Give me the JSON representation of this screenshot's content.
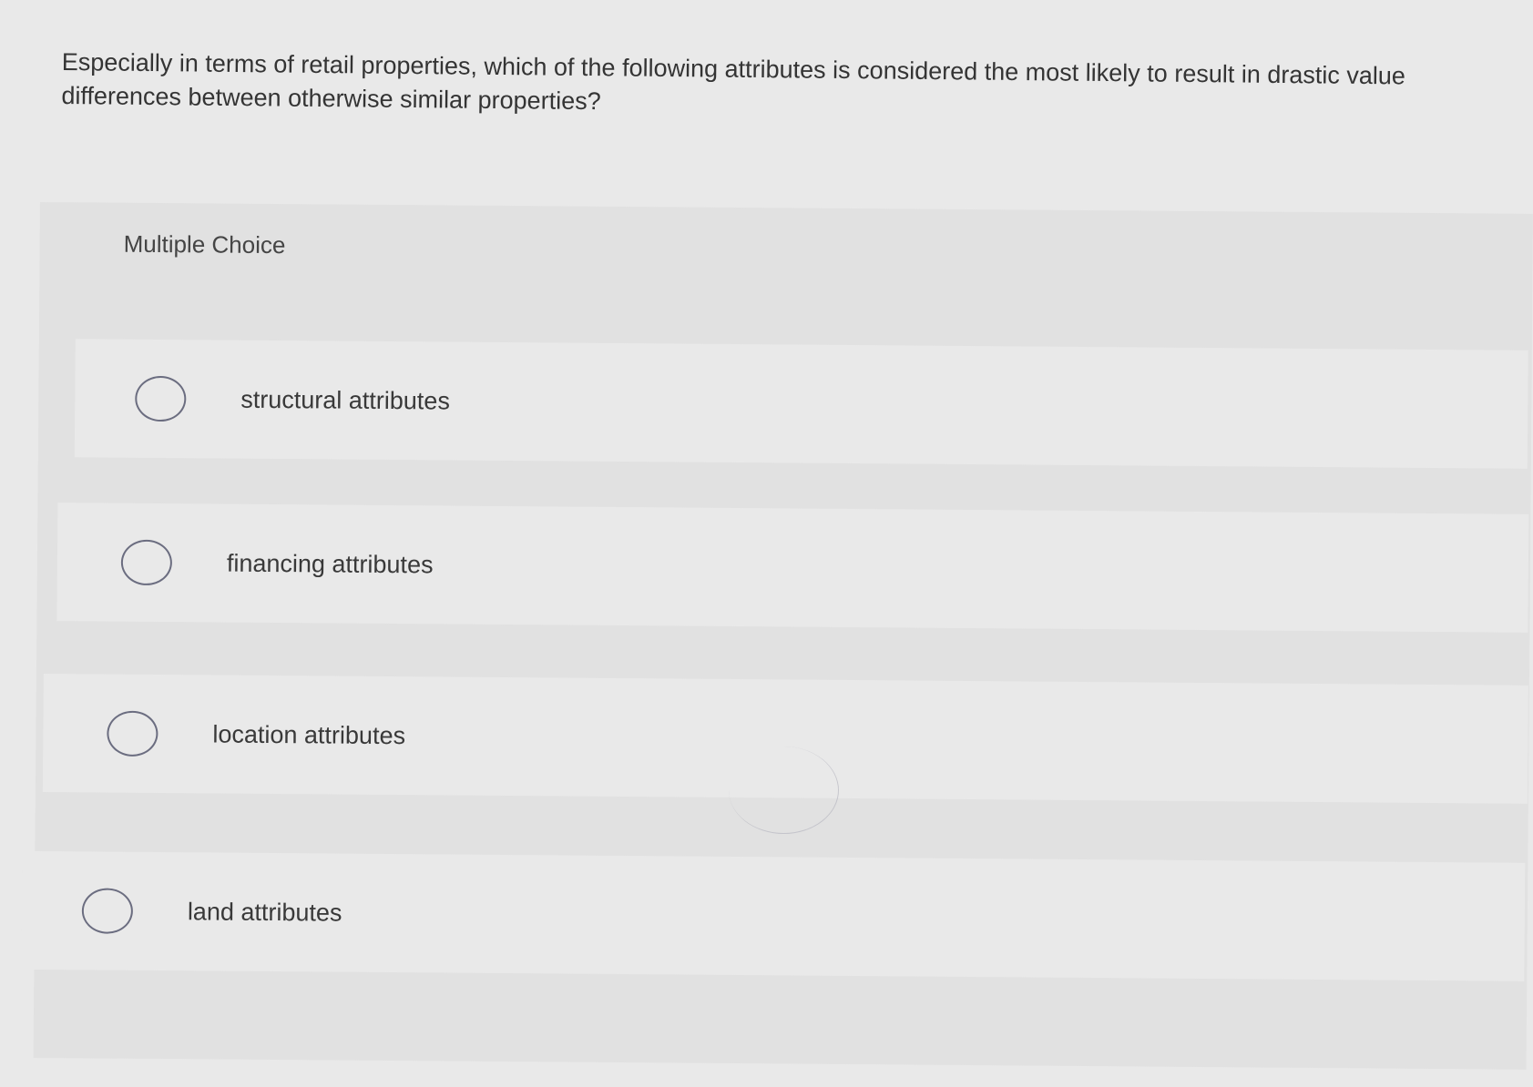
{
  "question": {
    "text": "Especially in terms of retail properties, which of the following attributes is considered the most likely to result in drastic value differences between otherwise similar properties?"
  },
  "multiple_choice": {
    "label": "Multiple Choice",
    "options": [
      {
        "label": "structural attributes"
      },
      {
        "label": "financing attributes"
      },
      {
        "label": "location attributes"
      },
      {
        "label": "land attributes"
      }
    ]
  },
  "colors": {
    "page_bg": "#e9e9e9",
    "panel_bg": "#e1e1e1",
    "radio_border": "#6b6d80",
    "text": "#393939"
  }
}
